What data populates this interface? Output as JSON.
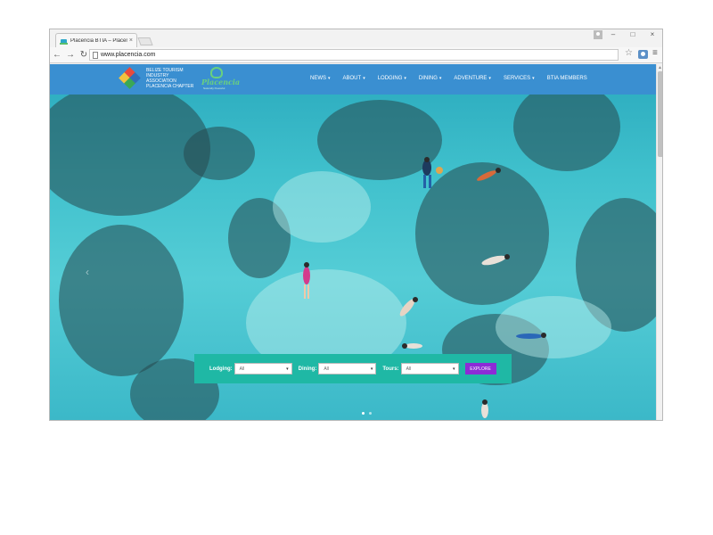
{
  "browser": {
    "tab_title": "Placencia BTIA – Placencia",
    "tab_close": "×",
    "url": "www.placencia.com",
    "controls": {
      "minimize": "–",
      "maximize": "□",
      "close": "×"
    },
    "nav": {
      "back": "←",
      "forward": "→",
      "reload": "↻"
    },
    "star": "☆",
    "menu": "≡"
  },
  "site": {
    "logo_lines": [
      "BELIZE TOURISM",
      "INDUSTRY",
      "ASSOCIATION",
      "PLACENCIA CHAPTER"
    ],
    "logo2_script": "Placencia",
    "logo2_sub": "Naturally Peaceful",
    "nav_items": [
      {
        "label": "NEWS",
        "caret": "▾"
      },
      {
        "label": "ABOUT",
        "caret": "▾"
      },
      {
        "label": "LODGING",
        "caret": "▾"
      },
      {
        "label": "DINING",
        "caret": "▾"
      },
      {
        "label": "ADVENTURE",
        "caret": "▾"
      },
      {
        "label": "SERVICES",
        "caret": "▾"
      },
      {
        "label": "BTIA MEMBERS",
        "caret": ""
      }
    ],
    "slider_prev": "‹"
  },
  "search": {
    "lodging_label": "Lodging:",
    "lodging_value": "All",
    "dining_label": "Dining:",
    "dining_value": "All",
    "tours_label": "Tours:",
    "tours_value": "All",
    "select_caret": "▾",
    "explore_label": "EXPLORE"
  },
  "colors": {
    "header_bg": "#3a8fd1",
    "search_bg": "#1fb8a5",
    "explore_bg": "#8c2bd6"
  }
}
